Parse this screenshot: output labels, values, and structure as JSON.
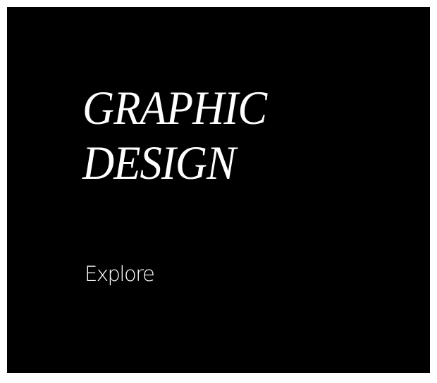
{
  "hero": {
    "title_line1": "GRAPHIC",
    "title_line2": "DESIGN",
    "explore_label": "Explore",
    "background_color": "#000000",
    "text_color": "#ffffff"
  }
}
